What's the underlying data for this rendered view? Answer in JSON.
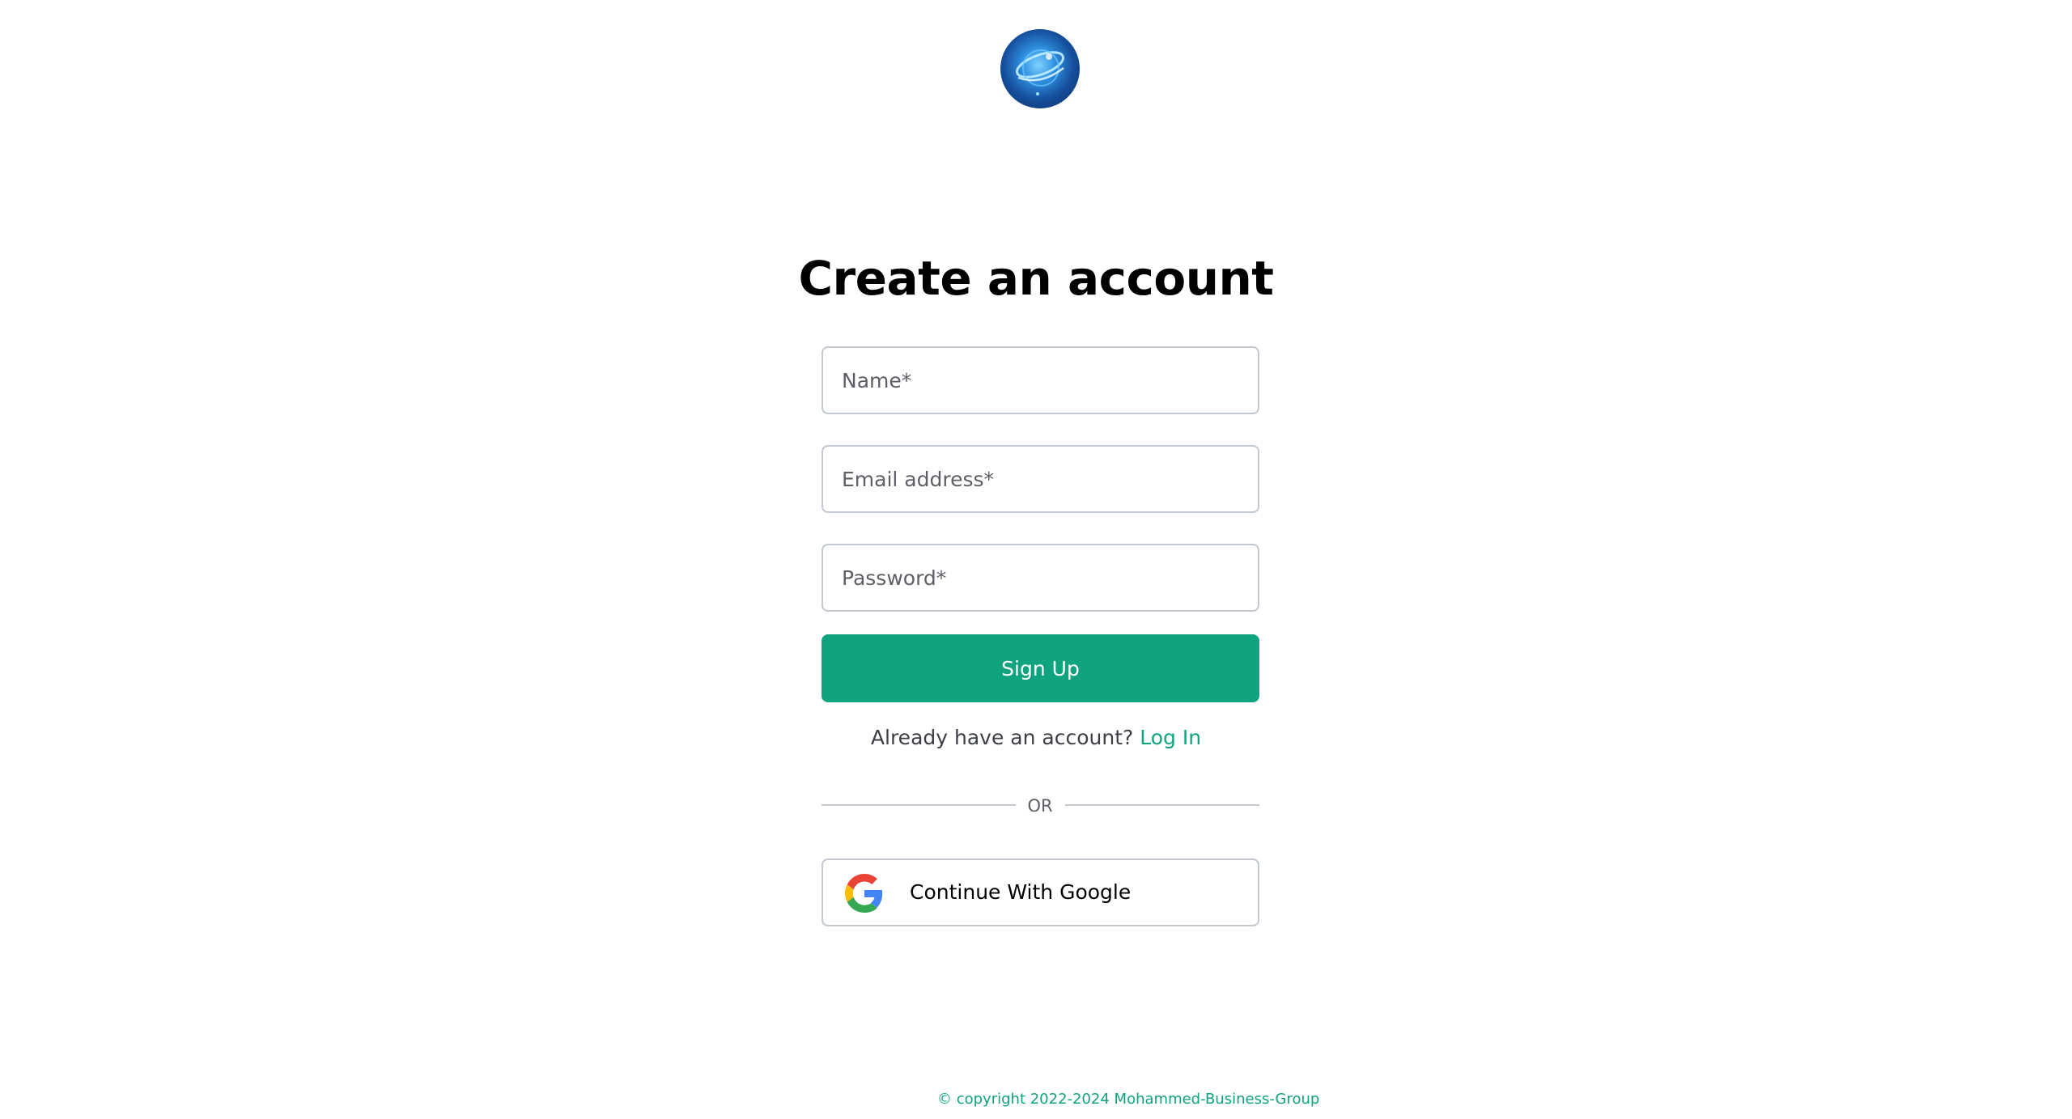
{
  "logo": {
    "icon": "orbit-globe-logo"
  },
  "page": {
    "title": "Create an account"
  },
  "form": {
    "name_placeholder": "Name*",
    "email_placeholder": "Email address*",
    "password_placeholder": "Password*",
    "signup_label": "Sign Up"
  },
  "login": {
    "prompt": "Already have an account?",
    "link_label": "Log In"
  },
  "divider": {
    "label": "OR"
  },
  "google": {
    "label": "Continue With Google",
    "icon": "google-g-icon"
  },
  "footer": {
    "copyright": "© copyright 2022-2024 Mohammed-Business-Group"
  },
  "colors": {
    "accent": "#10a37f",
    "border": "#c2c8d0",
    "text": "#202123"
  }
}
